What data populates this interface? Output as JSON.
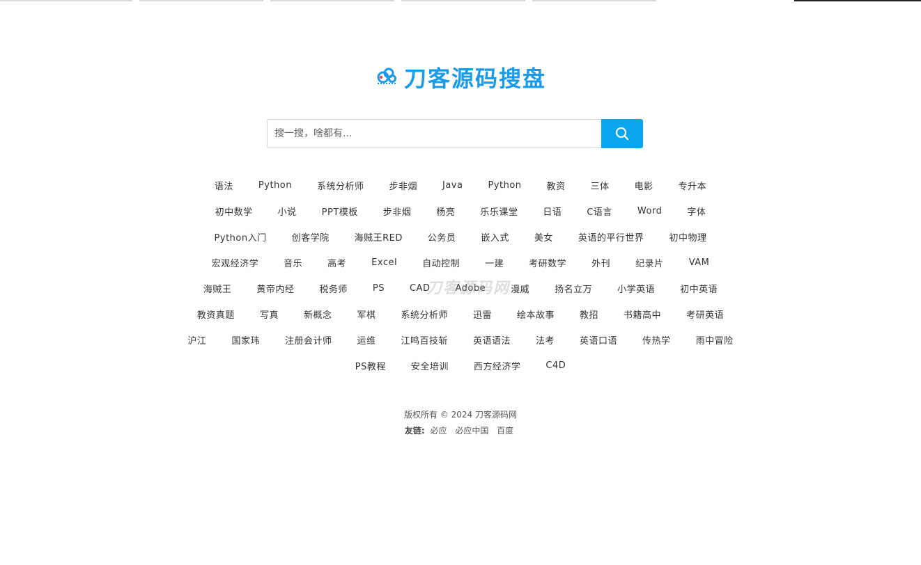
{
  "logo": {
    "text": "刀客源码搜盘",
    "color": "#1a9be8"
  },
  "search": {
    "placeholder": "搜一搜，啥都有...",
    "value": "",
    "button_icon": "search-icon",
    "button_color": "#0aa5ef"
  },
  "tags": [
    [
      "语法",
      "Python",
      "系统分析师",
      "步非烟",
      "Java",
      "Python",
      "教资",
      "三体",
      "电影",
      "专升本"
    ],
    [
      "初中数学",
      "小说",
      "PPT模板",
      "步非烟",
      "杨亮",
      "乐乐课堂",
      "日语",
      "C语言",
      "Word",
      "字体"
    ],
    [
      "Python入门",
      "创客学院",
      "海贼王RED",
      "公务员",
      "嵌入式",
      "美女",
      "英语的平行世界",
      "初中物理"
    ],
    [
      "宏观经济学",
      "音乐",
      "高考",
      "Excel",
      "自动控制",
      "一建",
      "考研数学",
      "外刊",
      "纪录片",
      "VAM"
    ],
    [
      "海贼王",
      "黄帝内经",
      "税务师",
      "PS",
      "CAD",
      "Adobe",
      "漫威",
      "扬名立万",
      "小学英语",
      "初中英语"
    ],
    [
      "教资真题",
      "写真",
      "新概念",
      "军棋",
      "系统分析师",
      "迅雷",
      "绘本故事",
      "教招",
      "书籍高中",
      "考研英语"
    ],
    [
      "沪江",
      "国家玮",
      "注册会计师",
      "运维",
      "江鸣百技斩",
      "英语语法",
      "法考",
      "英语口语",
      "传热学",
      "雨中冒险"
    ],
    [
      "PS教程",
      "安全培训",
      "西方经济学",
      "C4D"
    ]
  ],
  "watermark": "刀客源码网",
  "footer": {
    "copyright": "版权所有 © 2024 刀客源码网",
    "friend_label": "友链:",
    "links": [
      "必应",
      "必应中国",
      "百度"
    ]
  }
}
